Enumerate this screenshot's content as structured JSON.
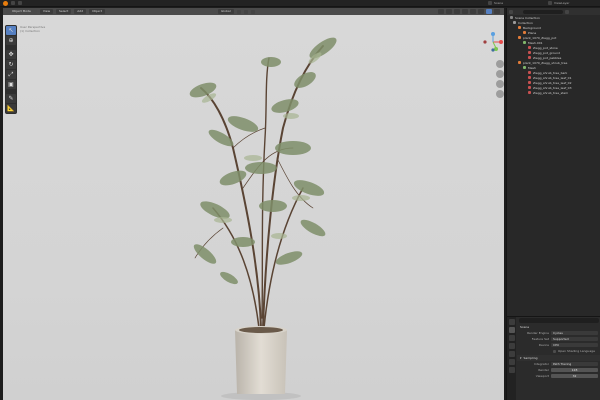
{
  "topbar": {
    "menus": [
      "File",
      "Edit",
      "Render",
      "Window",
      "Help"
    ],
    "scene_name": "Scene",
    "view_layer": "ViewLayer"
  },
  "viewport": {
    "mode": "Object Mode",
    "header_menus": [
      "View",
      "Select",
      "Add",
      "Object"
    ],
    "orientation": "Global",
    "info_lines": [
      "User Perspective",
      "(1) Collection"
    ]
  },
  "outliner": {
    "title": "Scene Collection",
    "items": [
      {
        "label": "Collection",
        "depth": 0,
        "color": "#9a9a9a"
      },
      {
        "label": "Background",
        "depth": 1,
        "color": "#e07b39"
      },
      {
        "label": "Plane",
        "depth": 2,
        "color": "#e07b39"
      },
      {
        "label": "plant_1070_Ziegg_pot",
        "depth": 1,
        "color": "#e07b39"
      },
      {
        "label": "Mesh.001",
        "depth": 2,
        "color": "#7fb56b"
      },
      {
        "label": "Ziegg_pot_stone",
        "depth": 3,
        "color": "#c85050"
      },
      {
        "label": "Ziegg_pot_ground",
        "depth": 3,
        "color": "#c85050"
      },
      {
        "label": "Ziegg_pot_pebbles",
        "depth": 3,
        "color": "#c85050"
      },
      {
        "label": "plant_1070_Ziegg_shrub_tree",
        "depth": 1,
        "color": "#e07b39"
      },
      {
        "label": "Mesh",
        "depth": 2,
        "color": "#7fb56b"
      },
      {
        "label": "Ziegg_shrub_tree_bark",
        "depth": 3,
        "color": "#c85050"
      },
      {
        "label": "Ziegg_shrub_tree_leaf_01",
        "depth": 3,
        "color": "#c85050"
      },
      {
        "label": "Ziegg_shrub_tree_leaf_02",
        "depth": 3,
        "color": "#c85050"
      },
      {
        "label": "Ziegg_shrub_tree_leaf_03",
        "depth": 3,
        "color": "#c85050"
      },
      {
        "label": "Ziegg_shrub_tree_stem",
        "depth": 3,
        "color": "#c85050"
      }
    ]
  },
  "properties": {
    "context_title": "Scene",
    "render_engine_label": "Render Engine",
    "render_engine_value": "Cycles",
    "feature_set_label": "Feature Set",
    "feature_set_value": "Supported",
    "device_label": "Device",
    "device_value": "CPU",
    "osl_label": "Open Shading Language",
    "sampling_title": "Sampling",
    "integrator_label": "Integrator",
    "integrator_value": "Path Tracing",
    "render_label": "Render",
    "render_value": "128",
    "viewport_label": "Viewport",
    "viewport_value": "32"
  }
}
